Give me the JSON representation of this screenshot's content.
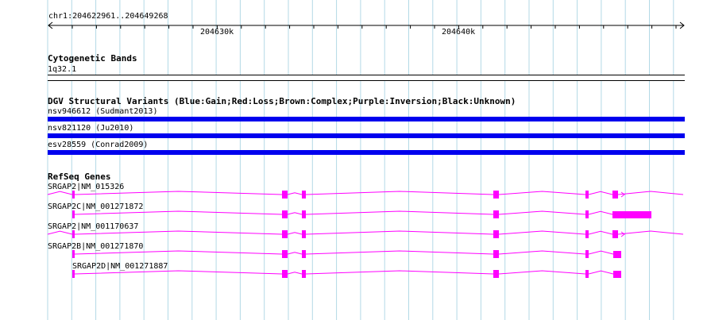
{
  "ruler": {
    "locus": "chr1:204622961..204649268",
    "ticks": [
      "204630k",
      "204640k"
    ]
  },
  "cytoband": {
    "title": "Cytogenetic Bands",
    "band": "1q32.1"
  },
  "dgv": {
    "title": "DGV Structural Variants (Blue:Gain;Red:Loss;Brown:Complex;Purple:Inversion;Black:Unknown)",
    "variants": [
      {
        "label": "nsv946612 (Sudmant2013)",
        "color": "#0000ee"
      },
      {
        "label": "nsv821120 (Ju2010)",
        "color": "#0000ee"
      },
      {
        "label": "esv28559 (Conrad2009)",
        "color": "#0000ee"
      }
    ]
  },
  "refseq": {
    "title": "RefSeq Genes",
    "color": "#ff00ff",
    "genes": [
      {
        "label": "SRGAP2|NM_015326"
      },
      {
        "label": "SRGAP2C|NM_001271872"
      },
      {
        "label": "SRGAP2|NM_001170637"
      },
      {
        "label": "SRGAP2B|NM_001271870"
      },
      {
        "label": "SRGAP2D|NM_001271887"
      }
    ]
  },
  "colors": {
    "grid": "#b3d9e6",
    "gene": "#ff00ff",
    "gain": "#0000ee"
  }
}
